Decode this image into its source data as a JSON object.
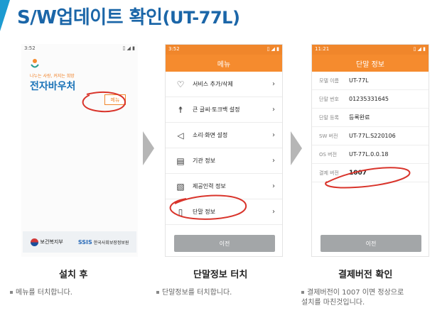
{
  "title": {
    "main": "S/W업데이트 확인",
    "suffix": "(UT-77L)"
  },
  "screen1": {
    "time": "3:52",
    "signal": "▯ ◢ ▮",
    "slogan": "나누는 사랑, 커지는 희망",
    "brand": "전자바우처",
    "menu_button": "메뉴",
    "footer": {
      "gov": "보건복지부",
      "ssis_mark": "SSIS",
      "ssis_text": "한국사회보장정보원"
    }
  },
  "screen2": {
    "time": "3:52",
    "signal": "▯ ◢ ▮",
    "header": "메뉴",
    "items": [
      {
        "label": "서비스 추가/삭제",
        "icon": "heart-plus-icon"
      },
      {
        "label": "큰 글씨·토크백 설정",
        "icon": "accessibility-icon"
      },
      {
        "label": "소리·화면 설정",
        "icon": "speaker-icon"
      },
      {
        "label": "기관 정보",
        "icon": "document-icon"
      },
      {
        "label": "제공인력 정보",
        "icon": "person-document-icon"
      },
      {
        "label": "단말 정보",
        "icon": "phone-device-icon"
      }
    ],
    "chevron": "›",
    "prev_button": "이전"
  },
  "screen3": {
    "time": "11:21",
    "signal": "▯ ◢ ▮",
    "header": "단말 정보",
    "rows": [
      {
        "key": "모델 이름",
        "value": "UT-77L"
      },
      {
        "key": "단말 번호",
        "value": "01235331645"
      },
      {
        "key": "단말 등록",
        "value": "등록완료"
      },
      {
        "key": "SW 버전",
        "value": "UT-77L.S220106"
      },
      {
        "key": "OS 버전",
        "value": "UT-77L.0.0.18"
      },
      {
        "key": "결제 버전",
        "value": "1007"
      }
    ],
    "prev_button": "이전"
  },
  "captions": [
    "설치 후",
    "단말정보 터치",
    "결제버전 확인"
  ],
  "notes": [
    "메뉴를 터치합니다.",
    "단말정보를 터치합니다.",
    "결제버전이 1007 이면 정상으로\n설치를 마친것입니다."
  ],
  "colors": {
    "title": "#1b66a8",
    "accent": "#f58b2e",
    "highlight_ring": "#d9342b",
    "brand": "#1a73b8"
  }
}
